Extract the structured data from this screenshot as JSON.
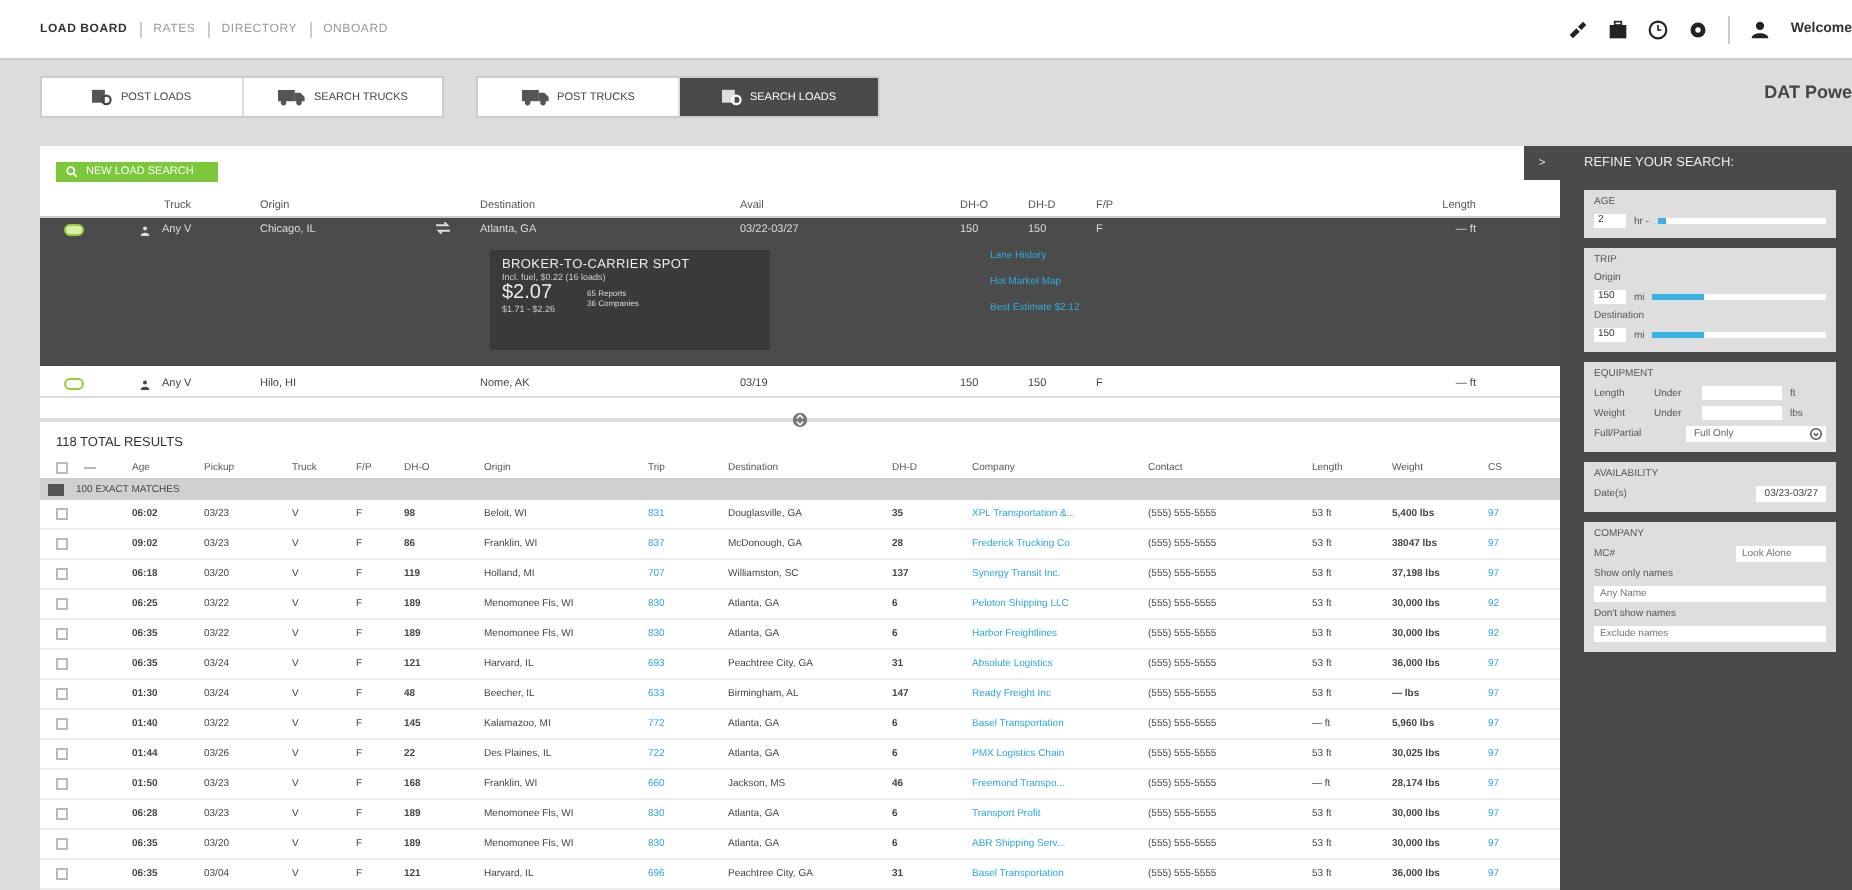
{
  "top_nav": {
    "links": [
      {
        "label": "LOAD BOARD",
        "selected": true
      },
      {
        "label": "RATES",
        "selected": false
      },
      {
        "label": "DIRECTORY",
        "selected": false
      },
      {
        "label": "ONBOARD",
        "selected": false
      }
    ],
    "welcome": "Welcome"
  },
  "brand": "DAT Powe",
  "tab_groups": [
    [
      {
        "label": "POST LOADS",
        "selected": false,
        "kind": "load"
      },
      {
        "label": "SEARCH TRUCKS",
        "selected": false,
        "kind": "truck"
      }
    ],
    [
      {
        "label": "POST TRUCKS",
        "selected": false,
        "kind": "truck"
      },
      {
        "label": "SEARCH LOADS",
        "selected": true,
        "kind": "load"
      }
    ]
  ],
  "new_search_button": "NEW LOAD SEARCH",
  "searches": {
    "columns": [
      "Truck",
      "Origin",
      "Destination",
      "Avail",
      "DH-O",
      "DH-D",
      "F/P",
      "Length"
    ],
    "rows": [
      {
        "expanded": true,
        "truck": "Any V",
        "origin": "Chicago, IL",
        "destination": "Atlanta, GA",
        "avail": "03/22-03/27",
        "dh_o": "150",
        "dh_d": "150",
        "fp": "F",
        "length": "— ft",
        "spot": {
          "title": "BROKER-TO-CARRIER SPOT",
          "subtitle": "Incl. fuel, $0.22 (16 loads)",
          "rate": "$2.07",
          "range": "$1.71 - $2.26",
          "reports": "65 Reports",
          "companies": "36 Companies"
        },
        "links": [
          "Lane History",
          "Hot Market Map",
          "Best Estimate $2.12"
        ]
      },
      {
        "expanded": false,
        "truck": "Any V",
        "origin": "Hilo, HI",
        "destination": "Nome, AK",
        "avail": "03/19",
        "dh_o": "150",
        "dh_d": "150",
        "fp": "F",
        "length": "— ft"
      }
    ]
  },
  "results": {
    "title": "118 TOTAL RESULTS",
    "select_all_checked": false,
    "columns": [
      "Age",
      "Pickup",
      "Truck",
      "F/P",
      "DH-O",
      "Origin",
      "Trip",
      "Destination",
      "DH-D",
      "Company",
      "Contact",
      "Length",
      "Weight",
      "CS"
    ],
    "group_label": "100 EXACT MATCHES",
    "rows": [
      {
        "checked": false,
        "cells": [
          "06:02",
          "03/23",
          "V",
          "F",
          "98",
          "Beloit, WI",
          "831",
          "Douglasville, GA",
          "35",
          "XPL Transportation &...",
          "(555) 555-5555",
          "53 ft",
          "5,400 lbs",
          "97"
        ]
      },
      {
        "checked": false,
        "cells": [
          "09:02",
          "03/23",
          "V",
          "F",
          "86",
          "Franklin, WI",
          "837",
          "McDonough, GA",
          "28",
          "Frederick Trucking Co",
          "(555) 555-5555",
          "53 ft",
          "38047 lbs",
          "97"
        ]
      },
      {
        "checked": false,
        "cells": [
          "06:18",
          "03/20",
          "V",
          "F",
          "119",
          "Holland, MI",
          "707",
          "Williamston, SC",
          "137",
          "Synergy Transit Inc.",
          "(555) 555-5555",
          "53 ft",
          "37,198 lbs",
          "97"
        ]
      },
      {
        "checked": false,
        "cells": [
          "06:25",
          "03/22",
          "V",
          "F",
          "189",
          "Menomonee Fls, WI",
          "830",
          "Atlanta, GA",
          "6",
          "Peloton Shipping LLC",
          "(555) 555-5555",
          "53 ft",
          "30,000 lbs",
          "92"
        ]
      },
      {
        "checked": false,
        "cells": [
          "06:35",
          "03/22",
          "V",
          "F",
          "189",
          "Menomonee Fls, WI",
          "830",
          "Atlanta, GA",
          "6",
          "Harbor Freightlines",
          "(555) 555-5555",
          "53 ft",
          "30,000 lbs",
          "92"
        ]
      },
      {
        "checked": false,
        "cells": [
          "06:35",
          "03/24",
          "V",
          "F",
          "121",
          "Harvard, IL",
          "693",
          "Peachtree City, GA",
          "31",
          "Absolute Logistics",
          "(555) 555-5555",
          "53 ft",
          "36,000 lbs",
          "97"
        ]
      },
      {
        "checked": false,
        "cells": [
          "01:30",
          "03/24",
          "V",
          "F",
          "48",
          "Beecher, IL",
          "633",
          "Birmingham, AL",
          "147",
          "Ready Freight Inc",
          "(555) 555-5555",
          "53 ft",
          "— lbs",
          "97"
        ]
      },
      {
        "checked": false,
        "cells": [
          "01:40",
          "03/22",
          "V",
          "F",
          "145",
          "Kalamazoo, MI",
          "772",
          "Atlanta, GA",
          "6",
          "Basel Transportation",
          "(555) 555-5555",
          "— ft",
          "5,960 lbs",
          "97"
        ]
      },
      {
        "checked": false,
        "cells": [
          "01:44",
          "03/26",
          "V",
          "F",
          "22",
          "Des Plaines, IL",
          "722",
          "Atlanta, GA",
          "6",
          "PMX Logistics Chain",
          "(555) 555-5555",
          "53 ft",
          "30,025 lbs",
          "97"
        ]
      },
      {
        "checked": false,
        "cells": [
          "01:50",
          "03/23",
          "V",
          "F",
          "168",
          "Franklin, WI",
          "660",
          "Jackson, MS",
          "46",
          "Freemond Transpo...",
          "(555) 555-5555",
          "— ft",
          "28,174 lbs",
          "97"
        ]
      },
      {
        "checked": false,
        "cells": [
          "06:28",
          "03/23",
          "V",
          "F",
          "189",
          "Menomonee Fls, WI",
          "830",
          "Atlanta, GA",
          "6",
          "Transport Profit",
          "(555) 555-5555",
          "53 ft",
          "30,000 lbs",
          "97"
        ]
      },
      {
        "checked": false,
        "cells": [
          "06:35",
          "03/20",
          "V",
          "F",
          "189",
          "Menomonee Fls, WI",
          "830",
          "Atlanta, GA",
          "6",
          "ABR Shipping Serv...",
          "(555) 555-5555",
          "53 ft",
          "30,000 lbs",
          "97"
        ]
      },
      {
        "checked": false,
        "cells": [
          "06:35",
          "03/04",
          "V",
          "F",
          "121",
          "Harvard, IL",
          "696",
          "Peachtree City, GA",
          "31",
          "Basel Transportation",
          "(555) 555-5555",
          "53 ft",
          "36,000 lbs",
          "97"
        ]
      }
    ]
  },
  "refine": {
    "collapse_button": ">",
    "title": "REFINE YOUR SEARCH:",
    "age": {
      "title": "AGE",
      "value": "2",
      "unit": "hr -",
      "level": 0.05
    },
    "trip": {
      "title": "TRIP",
      "sliders": [
        {
          "label": "Origin",
          "value": "150",
          "unit": "mi",
          "level": 0.3
        },
        {
          "label": "Destination",
          "value": "150",
          "unit": "mi",
          "level": 0.3
        }
      ]
    },
    "equipment": {
      "title": "EQUIPMENT",
      "limits": [
        {
          "label": "Length",
          "qualifier": "Under",
          "unit": "ft"
        },
        {
          "label": "Weight",
          "qualifier": "Under",
          "unit": "lbs"
        }
      ],
      "full_partial": {
        "label": "Full/Partial",
        "value": "Full Only"
      }
    },
    "availability": {
      "title": "AVAILABILITY",
      "label": "Date(s)",
      "value": "03/23-03/27"
    },
    "company": {
      "title": "COMPANY",
      "mc_label": "MC#",
      "mc_placeholder": "Look Alone",
      "show_label": "Show only names",
      "show_placeholder": "Any Name",
      "hide_label": "Don't show names",
      "hide_placeholder": "Exclude names"
    }
  }
}
